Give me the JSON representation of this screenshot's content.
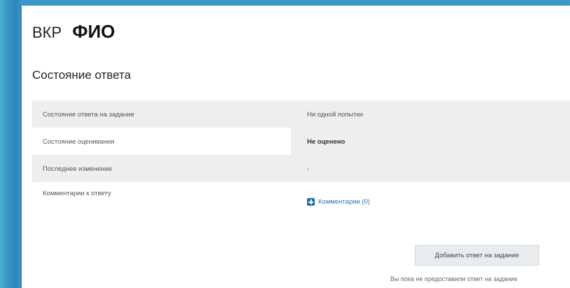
{
  "header": {
    "prefix": "ВКР",
    "name": "ФИО"
  },
  "section": {
    "heading": "Состояние ответа"
  },
  "status_table": {
    "rows": [
      {
        "label": "Состояние ответа на задание",
        "value": "Ни одной попытки"
      },
      {
        "label": "Состояние оценивания",
        "value": "Не оценено"
      },
      {
        "label": "Последнее изменение",
        "value": "-"
      },
      {
        "label": "Комментарии к ответу",
        "value": "Комментарии (0)"
      }
    ]
  },
  "actions": {
    "add_submission_label": "Добавить ответ на задание",
    "no_submission_note": "Вы пока не предоставили ответ на задание"
  },
  "colors": {
    "accent": "#1f77b4",
    "row_shade": "#eeeeee",
    "background": "#3a98c8"
  },
  "icons": {
    "comments": "plus-square-icon"
  }
}
